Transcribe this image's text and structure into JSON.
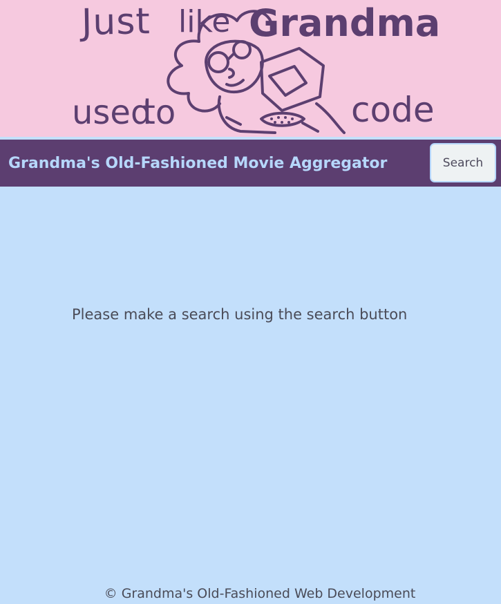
{
  "banner": {
    "logo_words": {
      "just": "Just",
      "like": "like",
      "grandma": "Grandma",
      "used": "used",
      "to": "to",
      "code": "code"
    },
    "colors": {
      "background": "#f6c9df",
      "ink": "#5c3f70"
    }
  },
  "navbar": {
    "brand": "Grandma's Old-Fashioned Movie Aggregator",
    "search_label": "Search",
    "colors": {
      "background": "#5c3e70",
      "brand_text": "#b6d7fb"
    }
  },
  "main": {
    "prompt": "Please make a search using the search button",
    "background": "#c3dffb"
  },
  "footer": {
    "text": "© Grandma's Old-Fashioned Web Development"
  }
}
